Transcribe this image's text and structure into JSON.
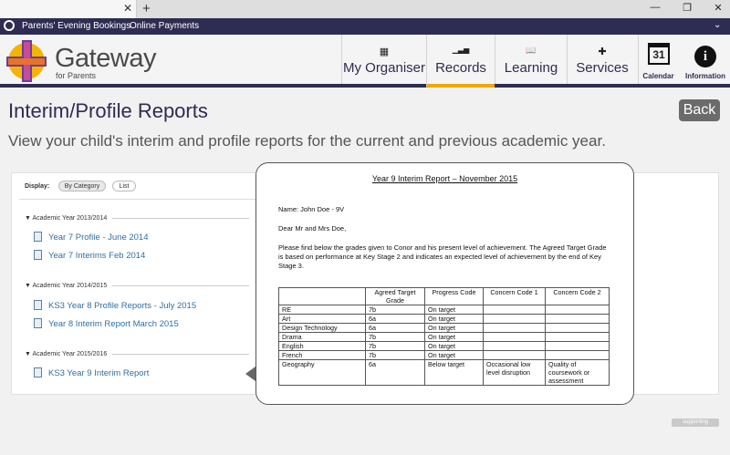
{
  "browser": {
    "tab_close": "✕",
    "new_tab": "+",
    "minimize": "—",
    "restore": "❐",
    "close": "✕"
  },
  "quicklinks": {
    "items": [
      "Parents' Evening Bookings",
      "Online Payments"
    ],
    "chevron": "⌄"
  },
  "brand": {
    "name": "Gateway",
    "sub": "for Parents"
  },
  "nav": [
    {
      "label": "My Organiser",
      "icon": "grid-icon",
      "glyph": "▦"
    },
    {
      "label": "Records",
      "icon": "chart-icon",
      "glyph": "▁▃▅"
    },
    {
      "label": "Learning",
      "icon": "book-icon",
      "glyph": "📖"
    },
    {
      "label": "Services",
      "icon": "signpost-icon",
      "glyph": "✚"
    }
  ],
  "calendar": {
    "day": "31",
    "label": "Calendar"
  },
  "information": {
    "glyph": "i",
    "label": "Information"
  },
  "page": {
    "title": "Interim/Profile Reports",
    "back": "Back",
    "subtitle": "View your child's interim and profile reports for the current and previous academic year."
  },
  "display": {
    "label": "Display:",
    "by_category": "By Category",
    "list": "List"
  },
  "groups": [
    {
      "year": "▼ Academic Year 2013/2014",
      "reports": [
        "Year 7 Profile - June 2014",
        "Year 7 Interims Feb 2014"
      ]
    },
    {
      "year": "▼ Academic Year 2014/2015",
      "reports": [
        "KS3 Year 8 Profile Reports - July 2015",
        "Year 8 Interim Report March 2015"
      ]
    },
    {
      "year": "▼ Academic Year 2015/2016",
      "reports": [
        "KS3 Year 9 Interim Report"
      ]
    }
  ],
  "report": {
    "title": "Year 9 Interim Report – November 2015",
    "name": "Name:  John Doe - 9V",
    "greeting": "Dear Mr and Mrs Doe,",
    "body": "Please find below the grades given to Conor and his present level of achievement. The Agreed Target Grade is based on performance at Key Stage 2 and indicates an expected level of achievement by the end of Key Stage 3.",
    "columns": [
      "",
      "Agreed Target Grade",
      "Progress Code",
      "Concern Code 1",
      "Concern Code 2"
    ],
    "rows": [
      [
        "RE",
        "7b",
        "On target",
        "",
        ""
      ],
      [
        "Art",
        "6a",
        "On target",
        "",
        ""
      ],
      [
        "Design Technology",
        "6a",
        "On target",
        "",
        ""
      ],
      [
        "Drama",
        "7b",
        "On target",
        "",
        ""
      ],
      [
        "English",
        "7b",
        "On target",
        "",
        ""
      ],
      [
        "French",
        "7b",
        "On target",
        "",
        ""
      ],
      [
        "Geography",
        "6a",
        "Below target",
        "Occasional low level disruption",
        "Quality of coursework or assessment"
      ]
    ]
  },
  "badge": "supporting"
}
